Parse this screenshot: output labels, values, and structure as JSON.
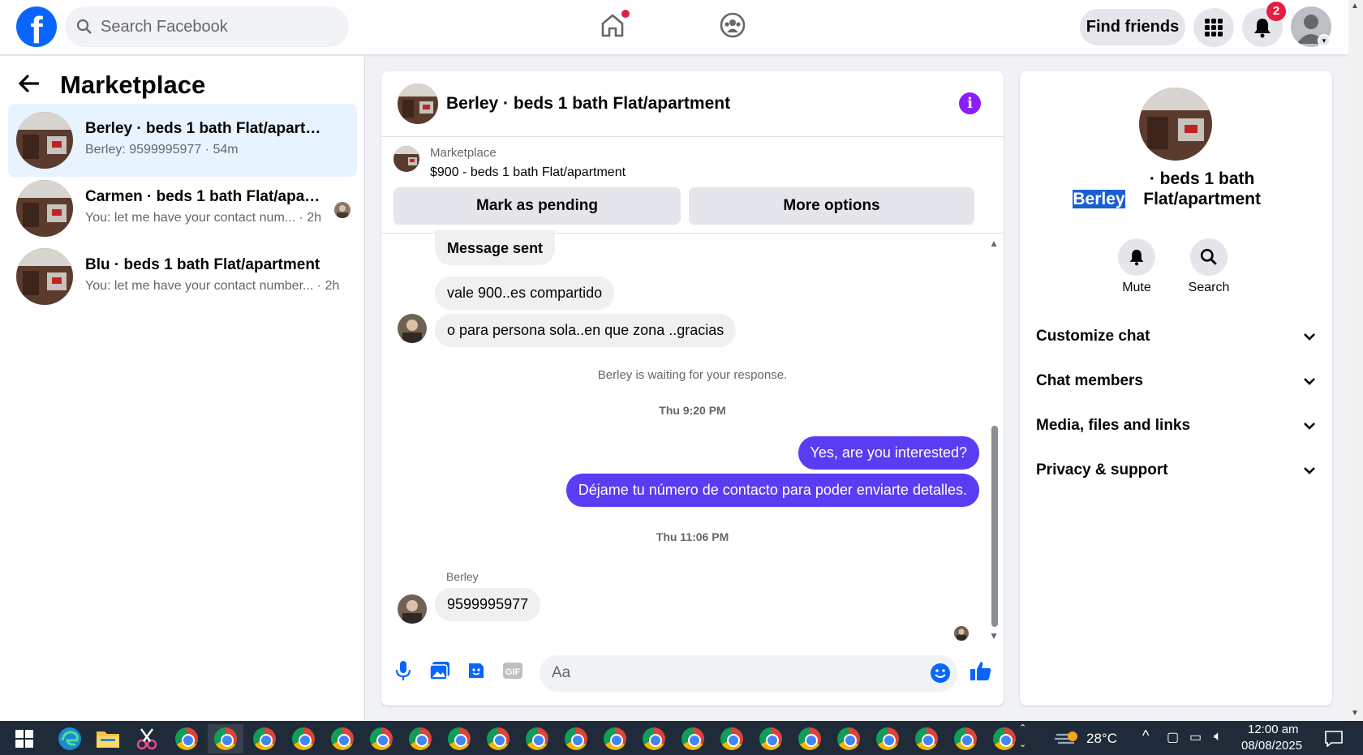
{
  "topbar": {
    "logo_letter": "f",
    "search_placeholder": "Search Facebook",
    "find_friends_label": "Find friends",
    "notification_count": "2"
  },
  "left": {
    "title": "Marketplace",
    "conversations": [
      {
        "title": "Berley · beds 1 bath Flat/apartment",
        "subtitle": "Berley: 9599995977 · 54m"
      },
      {
        "title": "Carmen · beds 1 bath Flat/apart...",
        "subtitle": "You: let me have your contact num... · 2h"
      },
      {
        "title": "Blu · beds 1 bath Flat/apartment",
        "subtitle": "You: let me have your contact number... · 2h"
      }
    ]
  },
  "chat": {
    "title": "Berley · beds 1 bath Flat/apartment",
    "listing_label": "Marketplace",
    "listing_price": "$900 - beds 1 bath Flat/apartment",
    "mark_pending_label": "Mark as pending",
    "more_options_label": "More options",
    "messages": {
      "m1": "Message sent",
      "m2": "vale 900..es compartido",
      "m3": "o para persona sola..en que zona ..gracias",
      "waiting": "Berley is waiting for your response.",
      "ts1": "Thu 9:20 PM",
      "m4": "Yes, are you interested?",
      "m5": "Déjame tu número de contacto para poder enviarte detalles.",
      "ts2": "Thu 11:06 PM",
      "sender": "Berley",
      "m6": "9599995977"
    },
    "composer_placeholder": "Aa"
  },
  "right": {
    "title_highlight": "Berley",
    "title_rest": " · beds 1 bath Flat/apartment",
    "mute_label": "Mute",
    "search_label": "Search",
    "sections": [
      "Customize chat",
      "Chat members",
      "Media, files and links",
      "Privacy & support"
    ]
  },
  "taskbar": {
    "temperature": "28°C",
    "time": "12:00 am",
    "date": "08/08/2025"
  },
  "colors": {
    "brand": "#0866ff",
    "outgoing_bubble": "#5a3cf3",
    "active_convo": "#e7f3ff",
    "info": "#8a1ef7"
  }
}
